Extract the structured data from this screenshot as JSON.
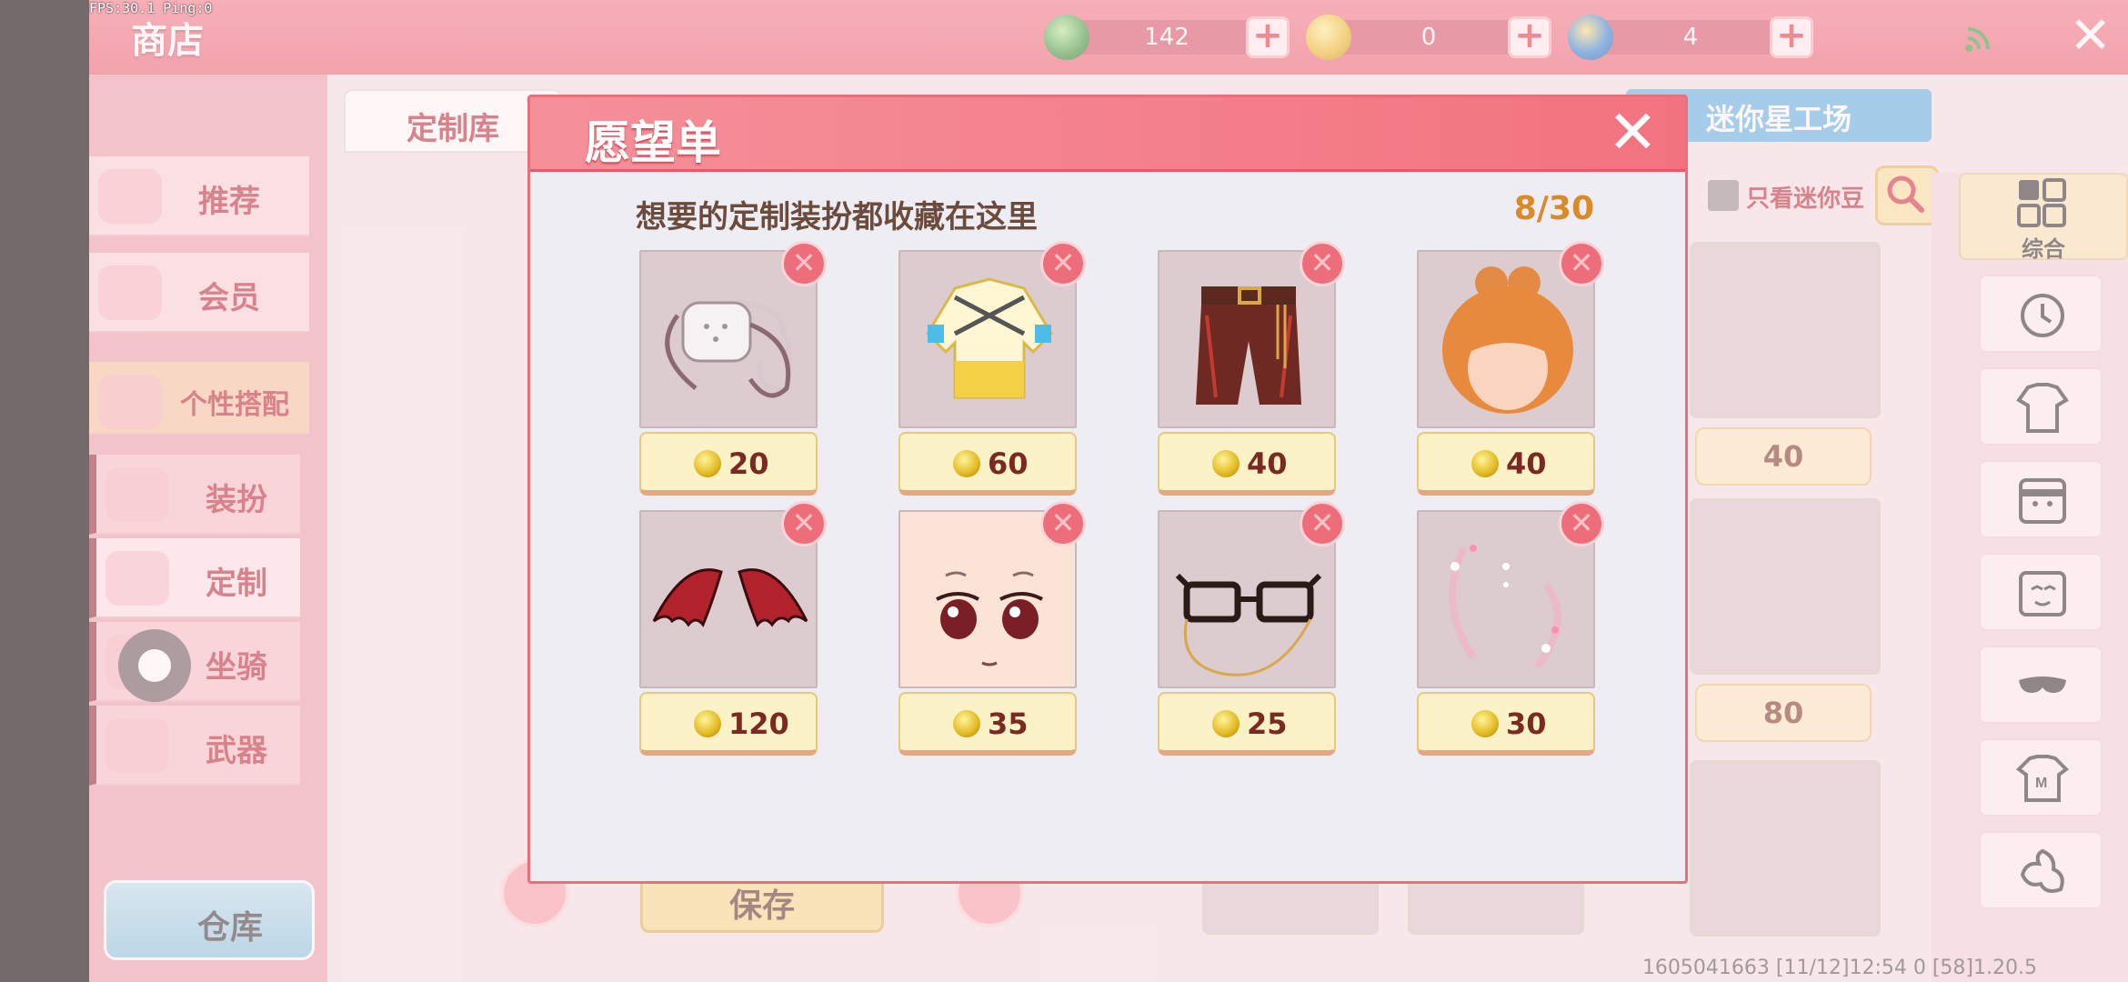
{
  "status": {
    "fps_ping": "FPS:30.1  Ping:0"
  },
  "header": {
    "title": "商店",
    "close_label": "✕"
  },
  "currencies": [
    {
      "name": "green-gem",
      "value": "142",
      "color": "#3a9a3a"
    },
    {
      "name": "gold-coin",
      "value": "0",
      "color": "#e6b820"
    },
    {
      "name": "blue-coin",
      "value": "4",
      "color": "#2f86d8"
    }
  ],
  "tabs": {
    "custom_library": "定制库",
    "mini_workshop": "迷你星工场"
  },
  "filters": {
    "only_mini_beans": "只看迷你豆"
  },
  "left_nav": {
    "recommend": "推荐",
    "member": "会员",
    "personal_match": "个性搭配",
    "outfit": "装扮",
    "custom": "定制",
    "mount": "坐骑",
    "weapon": "武器",
    "warehouse": "仓库"
  },
  "right_nav": {
    "all": "综合"
  },
  "background": {
    "save": "保存",
    "prices": [
      "40",
      "80"
    ]
  },
  "footer": {
    "info": "1605041663   [11/12]12:54 0      [58]1.20.5"
  },
  "dialog": {
    "title": "愿望单",
    "close": "✕",
    "subtitle": "想要的定制装扮都收藏在这里",
    "count": "8/30",
    "items": [
      {
        "name": "mask",
        "price": "20"
      },
      {
        "name": "jacket",
        "price": "60"
      },
      {
        "name": "shorts",
        "price": "40"
      },
      {
        "name": "hair-bun",
        "price": "40"
      },
      {
        "name": "devil-wings",
        "price": "120"
      },
      {
        "name": "face",
        "price": "35"
      },
      {
        "name": "glasses",
        "price": "25"
      },
      {
        "name": "sparkle-effect",
        "price": "30"
      }
    ],
    "remove_label": "✕"
  }
}
